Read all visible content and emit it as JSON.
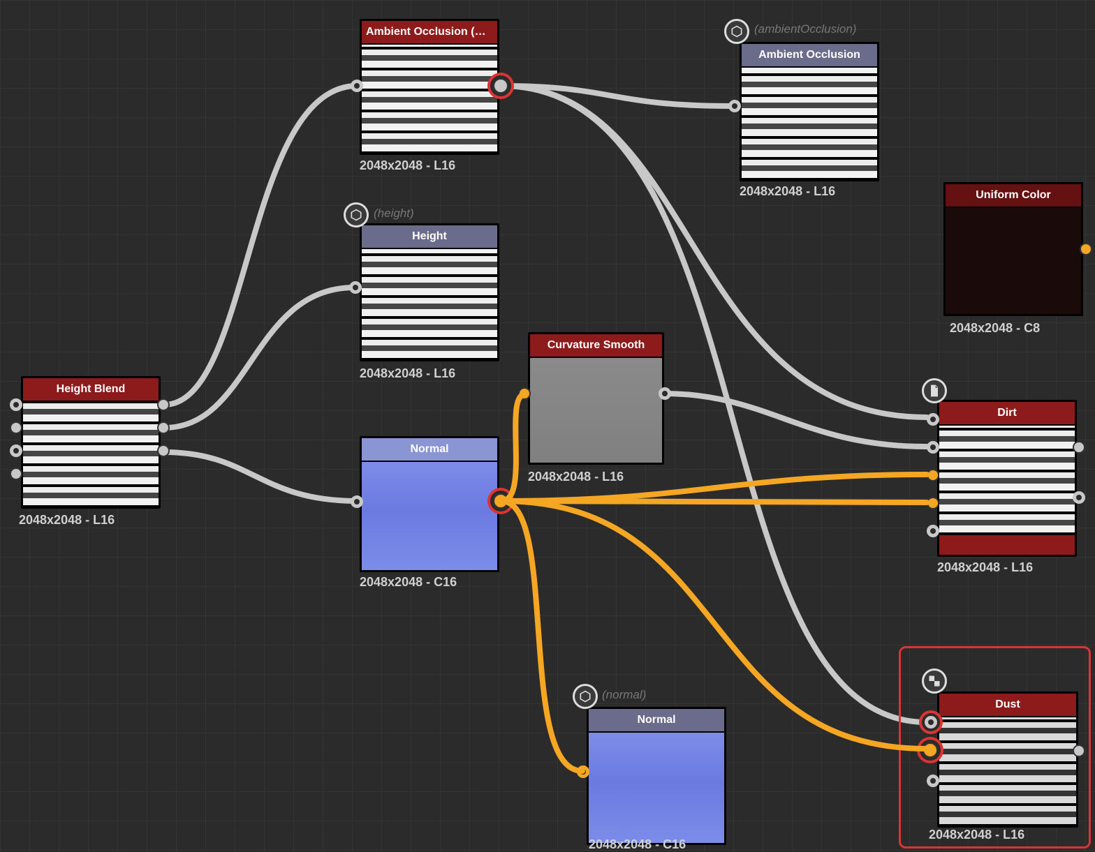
{
  "nodes": {
    "heightBlend": {
      "title": "Height Blend",
      "res": "2048x2048 - L16"
    },
    "aoHB": {
      "title": "Ambient Occlusion (HB...",
      "res": "2048x2048 - L16"
    },
    "aoOut": {
      "title": "Ambient Occlusion",
      "res": "2048x2048 - L16",
      "tag": "(ambientOcclusion)"
    },
    "heightOut": {
      "title": "Height",
      "res": "2048x2048 - L16",
      "tag": "(height)"
    },
    "curvature": {
      "title": "Curvature Smooth",
      "res": "2048x2048 - L16"
    },
    "uniformColor": {
      "title": "Uniform Color",
      "res": "2048x2048 - C8"
    },
    "normal": {
      "title": "Normal",
      "res": "2048x2048 - C16"
    },
    "normalOut": {
      "title": "Normal",
      "res": "2048x2048 - C16",
      "tag": "(normal)"
    },
    "dirt": {
      "title": "Dirt",
      "res": "2048x2048 - L16"
    },
    "dust": {
      "title": "Dust",
      "res": "2048x2048 - L16"
    }
  },
  "colors": {
    "wire_gray": "#c8c8c8",
    "wire_color": "#f5a623"
  }
}
